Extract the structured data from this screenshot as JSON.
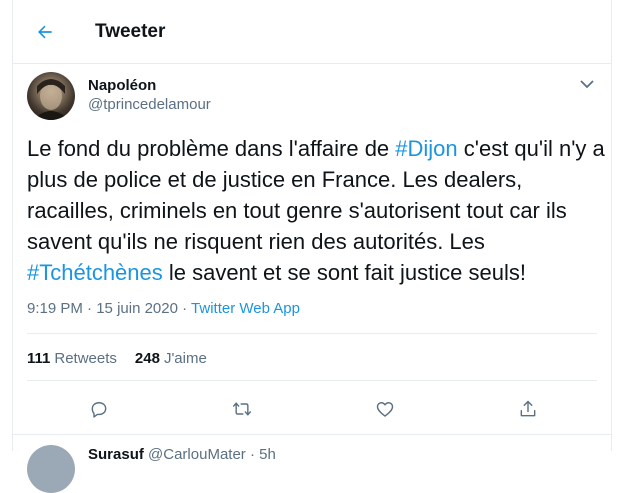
{
  "header": {
    "title": "Tweeter",
    "back_icon": "back-arrow-icon",
    "accent": "#1b95e0"
  },
  "tweet": {
    "author_name": "Napoléon",
    "author_handle": "@tprincedelamour",
    "text_parts": [
      {
        "text": "Le fond du problème dans l'affaire de ",
        "type": "text"
      },
      {
        "text": "#Dijon",
        "type": "hashtag"
      },
      {
        "text": " c'est qu'il n'y a plus de police et de justice en France. Les dealers, racailles, criminels en tout genre s'autorisent tout car ils savent qu'ils ne risquent rien des autorités. Les ",
        "type": "text"
      },
      {
        "text": "#Tchétchènes",
        "type": "hashtag"
      },
      {
        "text": " le savent et se sont fait justice seuls!",
        "type": "text"
      }
    ],
    "time": "9:19 PM",
    "date": "15 juin 2020",
    "separator": "·",
    "source": "Twitter Web App",
    "retweets_count": "111",
    "retweets_label": "Retweets",
    "likes_count": "248",
    "likes_label": "J'aime",
    "actions": [
      "reply-icon",
      "retweet-icon",
      "like-icon",
      "share-icon"
    ]
  },
  "next_tweet": {
    "name_partial": "Surasuf",
    "handle_partial": "@CarlouMater",
    "time_partial": "· 5h"
  }
}
